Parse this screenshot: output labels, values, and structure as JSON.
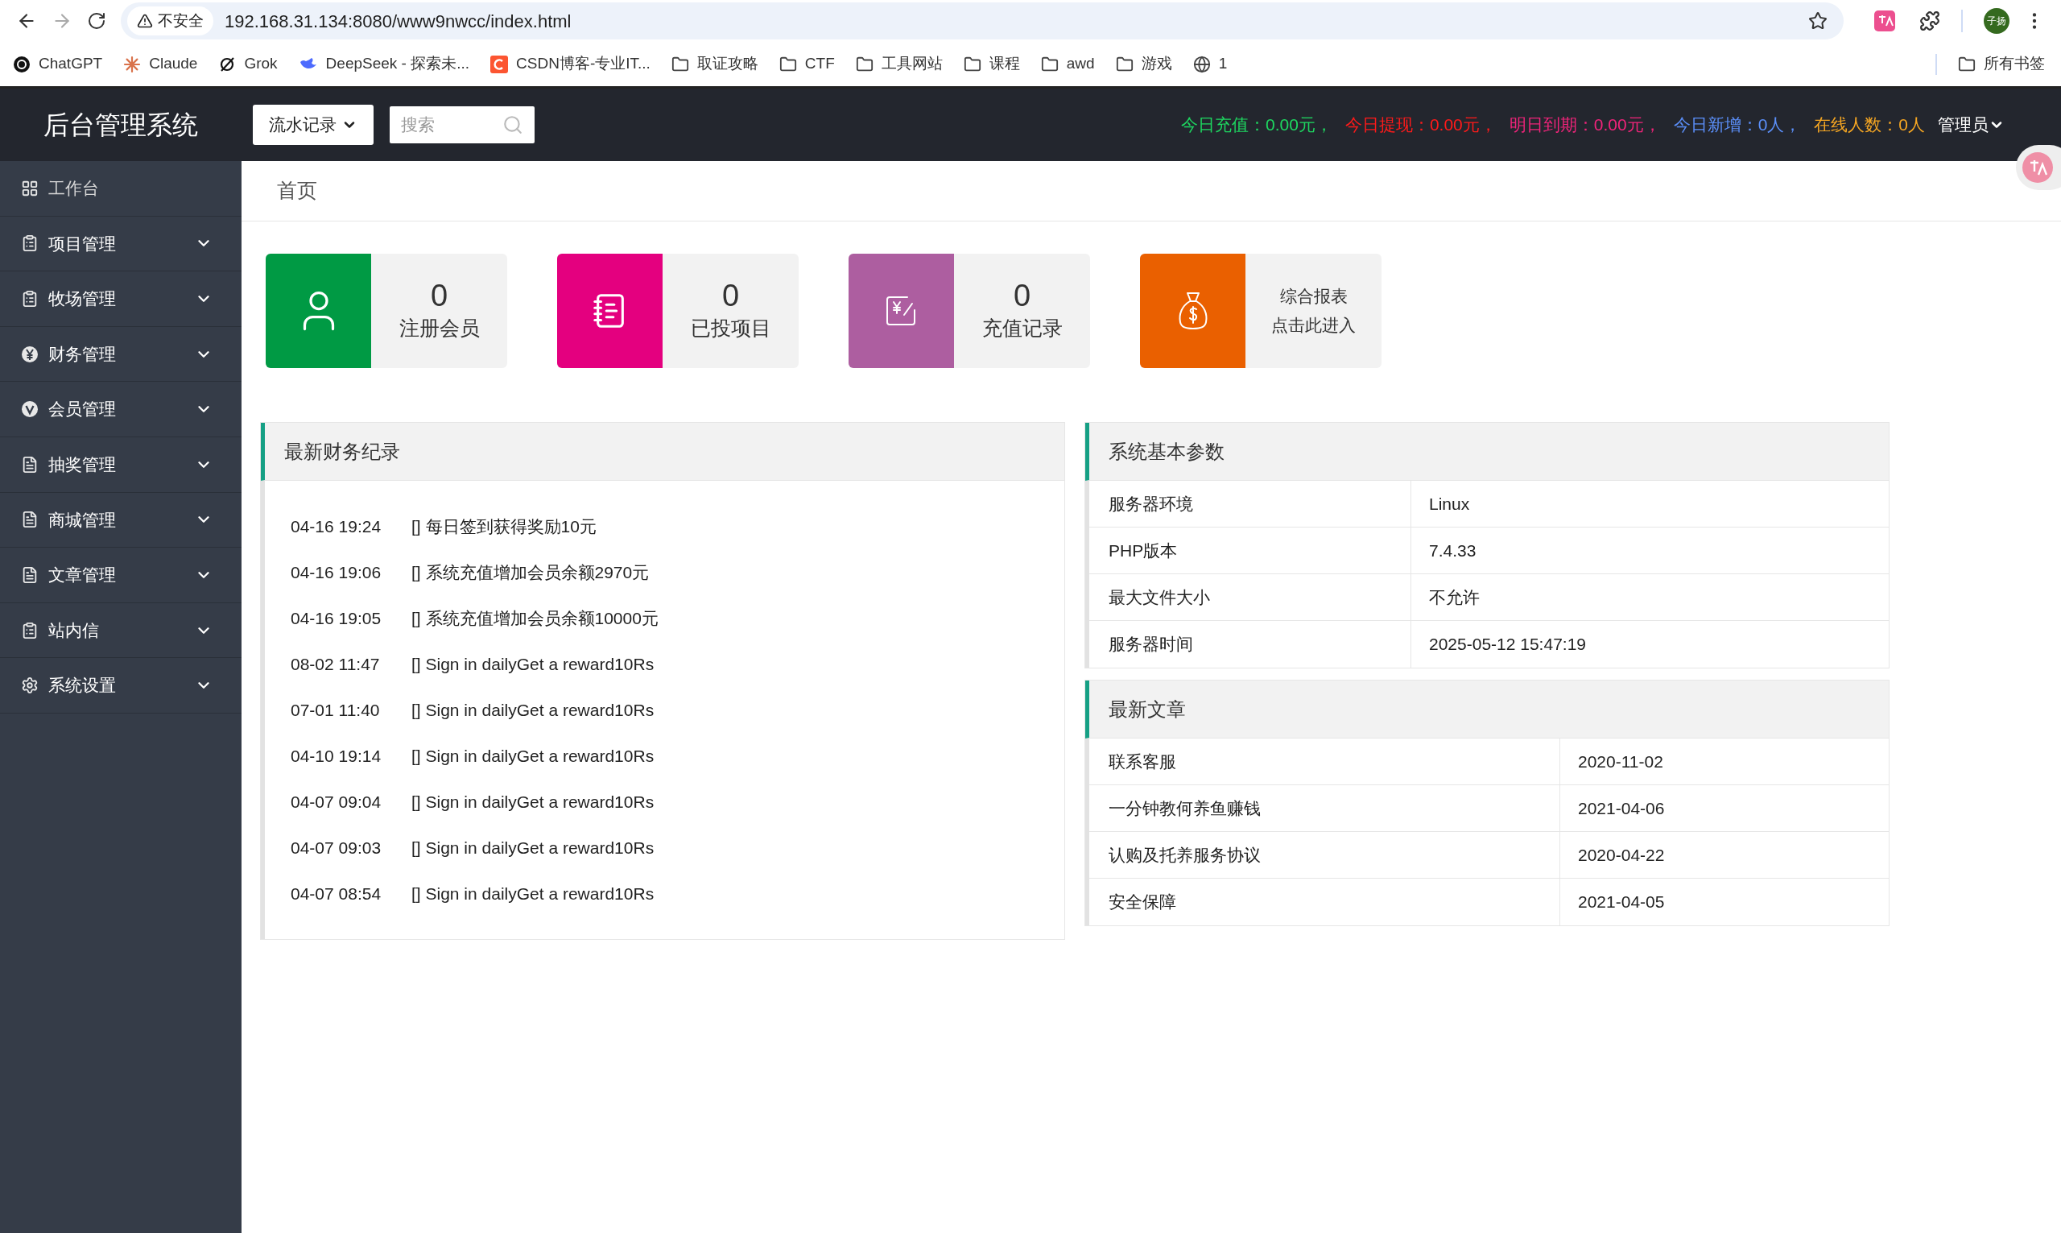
{
  "browser": {
    "security": "不安全",
    "url": "192.168.31.134:8080/www9nwcc/index.html",
    "avatar": "子扬",
    "bookmarks": [
      {
        "kind": "chatgpt",
        "label": "ChatGPT"
      },
      {
        "kind": "claude",
        "label": "Claude"
      },
      {
        "kind": "grok",
        "label": "Grok"
      },
      {
        "kind": "deepseek",
        "label": "DeepSeek - 探索未..."
      },
      {
        "kind": "csdn",
        "label": "CSDN博客-专业IT..."
      },
      {
        "kind": "folder",
        "label": "取证攻略"
      },
      {
        "kind": "folder",
        "label": "CTF"
      },
      {
        "kind": "folder",
        "label": "工具网站"
      },
      {
        "kind": "folder",
        "label": "课程"
      },
      {
        "kind": "folder",
        "label": "awd"
      },
      {
        "kind": "folder",
        "label": "游戏"
      },
      {
        "kind": "globe",
        "label": "1"
      }
    ],
    "all_bookmarks": "所有书签"
  },
  "header": {
    "title": "后台管理系统",
    "select": "流水记录",
    "search": {
      "placeholder": "搜索"
    },
    "stats": [
      {
        "text": "今日充值：0.00元，",
        "color": "#1ed760"
      },
      {
        "text": "今日提现：0.00元，",
        "color": "#ff1a1a"
      },
      {
        "text": "明日到期：0.00元，",
        "color": "#f0247a"
      },
      {
        "text": "今日新增：0人，",
        "color": "#5b8ff9"
      },
      {
        "text": "在线人数：0人",
        "color": "#f5a623"
      }
    ],
    "user": "管理员"
  },
  "sidebar": {
    "items": [
      {
        "kind": "grid",
        "label": "工作台",
        "expandable": false
      },
      {
        "kind": "clipboard",
        "label": "项目管理",
        "expandable": true
      },
      {
        "kind": "clipboard",
        "label": "牧场管理",
        "expandable": true
      },
      {
        "kind": "yen",
        "label": "财务管理",
        "expandable": true
      },
      {
        "kind": "v",
        "label": "会员管理",
        "expandable": true
      },
      {
        "kind": "doc",
        "label": "抽奖管理",
        "expandable": true
      },
      {
        "kind": "doc",
        "label": "商城管理",
        "expandable": true
      },
      {
        "kind": "doc",
        "label": "文章管理",
        "expandable": true
      },
      {
        "kind": "clipboard",
        "label": "站内信",
        "expandable": true
      },
      {
        "kind": "gear",
        "label": "系统设置",
        "expandable": true
      }
    ]
  },
  "breadcrumb": "首页",
  "cards": [
    {
      "kind": "stat",
      "color": "#009a44",
      "value": "0",
      "label": "注册会员"
    },
    {
      "kind": "stat",
      "color": "#e4007f",
      "value": "0",
      "label": "已投项目"
    },
    {
      "kind": "stat",
      "color": "#ad5ea0",
      "value": "0",
      "label": "充值记录"
    },
    {
      "kind": "link",
      "color": "#ea6000",
      "lines": [
        "综合报表",
        "点击此进入"
      ]
    }
  ],
  "finance": {
    "title": "最新财务纪录",
    "rows": [
      {
        "time": "04-16 19:24",
        "text": "[] 每日签到获得奖励10元"
      },
      {
        "time": "04-16 19:06",
        "text": "[] 系统充值增加会员余额2970元"
      },
      {
        "time": "04-16 19:05",
        "text": "[] 系统充值增加会员余额10000元"
      },
      {
        "time": "08-02 11:47",
        "text": "[] Sign in dailyGet a reward10Rs"
      },
      {
        "time": "07-01 11:40",
        "text": "[] Sign in dailyGet a reward10Rs"
      },
      {
        "time": "04-10 19:14",
        "text": "[] Sign in dailyGet a reward10Rs"
      },
      {
        "time": "04-07 09:04",
        "text": "[] Sign in dailyGet a reward10Rs"
      },
      {
        "time": "04-07 09:03",
        "text": "[] Sign in dailyGet a reward10Rs"
      },
      {
        "time": "04-07 08:54",
        "text": "[] Sign in dailyGet a reward10Rs"
      }
    ]
  },
  "system": {
    "title": "系统基本参数",
    "rows": [
      {
        "name": "服务器环境",
        "value": "Linux"
      },
      {
        "name": "PHP版本",
        "value": "7.4.33"
      },
      {
        "name": "最大文件大小",
        "value": "不允许"
      },
      {
        "name": "服务器时间",
        "value": "2025-05-12 15:47:19"
      }
    ]
  },
  "articles": {
    "title": "最新文章",
    "rows": [
      {
        "name": "联系客服",
        "value": "2020-11-02"
      },
      {
        "name": "一分钟教何养鱼赚钱",
        "value": "2021-04-06"
      },
      {
        "name": "认购及托养服务协议",
        "value": "2020-04-22"
      },
      {
        "name": "安全保障",
        "value": "2021-04-05"
      }
    ]
  }
}
